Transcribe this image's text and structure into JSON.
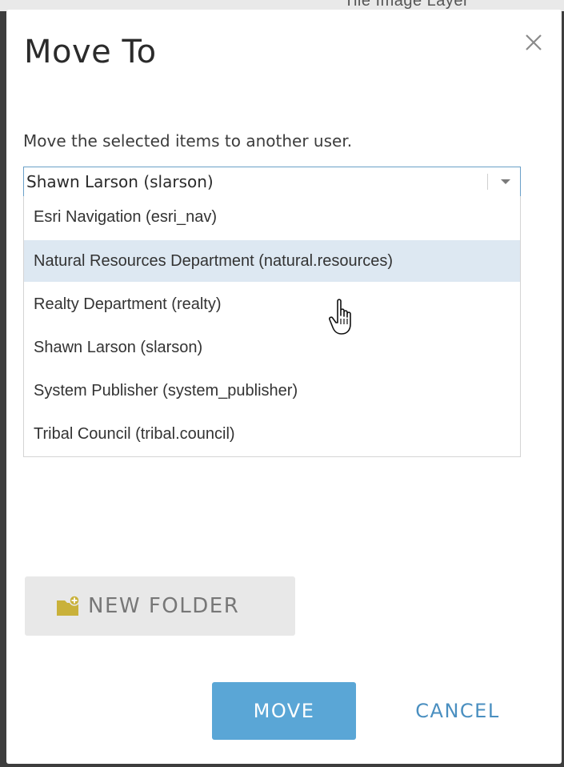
{
  "backdrop": {
    "partial_text": "Tile Image Layer"
  },
  "dialog": {
    "title": "Move To",
    "description": "Move the selected items to another user.",
    "combo": {
      "value": "Shawn Larson (slarson)"
    },
    "options": [
      {
        "label": "Esri Navigation (esri_nav)",
        "hovered": false
      },
      {
        "label": "Natural Resources Department (natural.resources)",
        "hovered": true
      },
      {
        "label": "Realty Department (realty)",
        "hovered": false
      },
      {
        "label": "Shawn Larson (slarson)",
        "hovered": false
      },
      {
        "label": "System Publisher (system_publisher)",
        "hovered": false
      },
      {
        "label": "Tribal Council (tribal.council)",
        "hovered": false
      }
    ],
    "new_folder_label": "NEW FOLDER",
    "move_label": "MOVE",
    "cancel_label": "CANCEL"
  },
  "colors": {
    "primary": "#5aa6d6",
    "link": "#4a8fc0",
    "hover_row": "#dde8f2",
    "folder_icon": "#c9b13a"
  }
}
